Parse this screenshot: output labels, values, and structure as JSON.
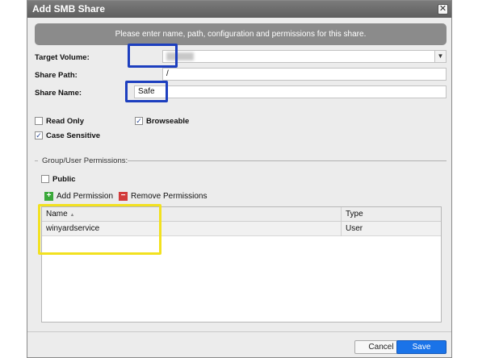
{
  "dialog": {
    "title": "Add SMB Share",
    "close_glyph": "✕",
    "banner": "Please enter name, path, configuration and permissions for this share."
  },
  "form": {
    "target_volume_label": "Target Volume:",
    "target_volume_value": "",
    "share_path_label": "Share Path:",
    "share_path_value": "/",
    "share_name_label": "Share Name:",
    "share_name_value": "Safe"
  },
  "options": {
    "read_only": {
      "label": "Read Only",
      "checked": false
    },
    "browseable": {
      "label": "Browseable",
      "checked": true
    },
    "case_sensitive": {
      "label": "Case Sensitive",
      "checked": true
    },
    "check_glyph": "✓"
  },
  "permissions": {
    "group_title": "Group/User Permissions:",
    "public_label": "Public",
    "add_label": "Add Permission",
    "add_glyph": "+",
    "remove_label": "Remove Permissions",
    "remove_glyph": "−",
    "columns": {
      "name": "Name",
      "sort_glyph": "▲",
      "type": "Type"
    },
    "rows": [
      {
        "name": "winyardservice",
        "type": "User"
      }
    ]
  },
  "footer": {
    "cancel_label": "Cancel",
    "save_label": "Save"
  },
  "colors": {
    "highlight_blue": "#1d3fbf",
    "highlight_yellow": "#f2e11f",
    "add_green": "#3aa83a",
    "remove_red": "#d23b3b",
    "primary_blue": "#1a73e8"
  },
  "icons": {
    "close": "close-icon",
    "dropdown": "chevron-down-icon",
    "add": "plus-icon",
    "remove": "minus-icon",
    "sort": "sort-ascending-icon"
  }
}
